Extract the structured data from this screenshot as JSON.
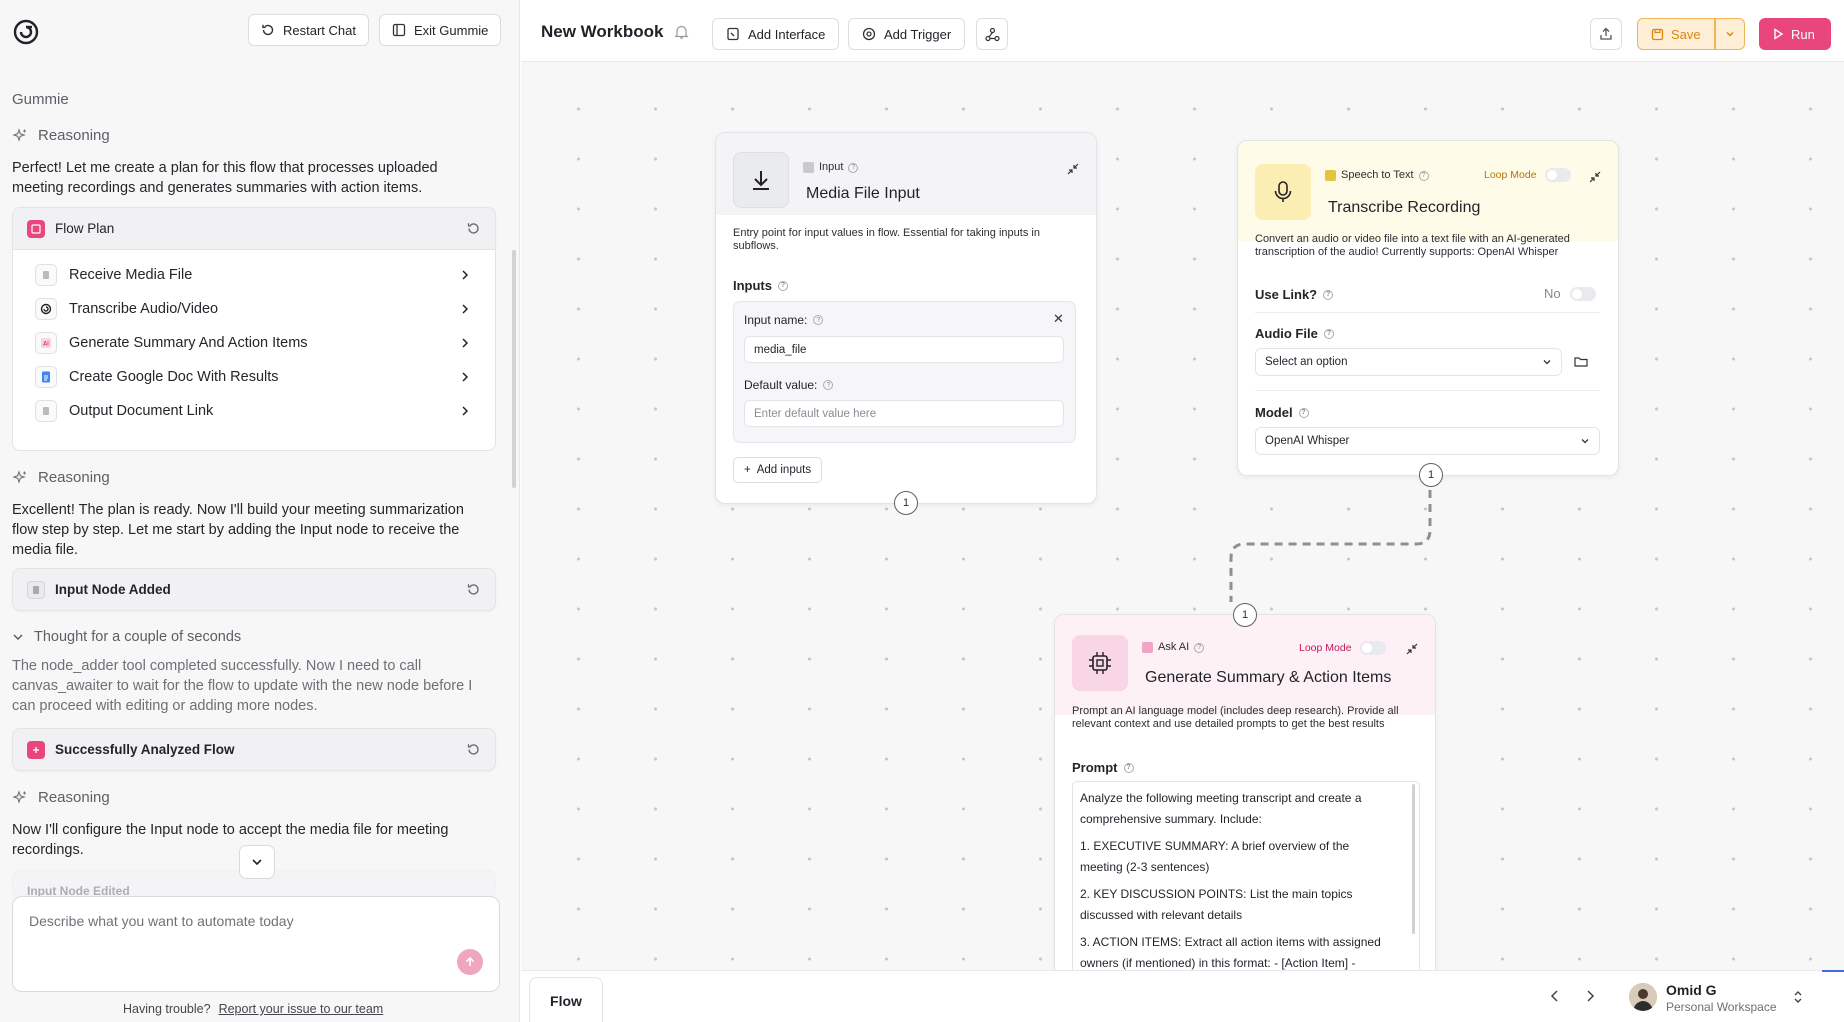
{
  "left_panel": {
    "restart_label": "Restart Chat",
    "exit_label": "Exit Gummie",
    "agent_name": "Gummie",
    "reasoning_label": "Reasoning",
    "msg1": "Perfect! Let me create a plan for this flow that processes uploaded meeting recordings and generates summaries with action items.",
    "flow_plan_title": "Flow Plan",
    "plan_items": [
      {
        "label": "Receive Media File"
      },
      {
        "label": "Transcribe Audio/Video"
      },
      {
        "label": "Generate Summary And Action Items"
      },
      {
        "label": "Create Google Doc With Results"
      },
      {
        "label": "Output Document Link"
      }
    ],
    "msg2": "Excellent! The plan is ready. Now I'll build your meeting summarization flow step by step. Let me start by adding the Input node to receive the media file.",
    "card_input_added": "Input Node Added",
    "thought_label": "Thought for a couple of seconds",
    "thought_text": "The node_adder tool completed successfully. Now I need to call canvas_awaiter to wait for the flow to update with the new node before I can proceed with editing or adding more nodes.",
    "card_analyzed": "Successfully Analyzed Flow",
    "msg3": "Now I'll configure the Input node to accept the media file for meeting recordings.",
    "card_edited": "Input Node Edited",
    "chat_placeholder": "Describe what you want to automate today",
    "trouble_text": "Having trouble?",
    "report_link": "Report your issue to our team"
  },
  "header": {
    "title": "New Workbook",
    "add_interface": "Add Interface",
    "add_trigger": "Add Trigger",
    "save": "Save",
    "run": "Run"
  },
  "nodes": {
    "input": {
      "type": "Input",
      "title": "Media File Input",
      "desc": "Entry point for input values in flow. Essential for taking inputs in subflows.",
      "inputs_label": "Inputs",
      "input_name_label": "Input name:",
      "input_name_value": "media_file",
      "default_label": "Default value:",
      "default_placeholder": "Enter default value here",
      "add_inputs": "Add inputs",
      "port": "1"
    },
    "speech": {
      "type": "Speech to Text",
      "loop_mode": "Loop Mode",
      "title": "Transcribe Recording",
      "desc": "Convert an audio or video file into a text file with an AI-generated transcription of the audio! Currently supports: OpenAI Whisper",
      "use_link_label": "Use Link?",
      "use_link_value": "No",
      "audio_file_label": "Audio File",
      "audio_file_placeholder": "Select an option",
      "model_label": "Model",
      "model_value": "OpenAI Whisper",
      "port": "1"
    },
    "askai": {
      "type": "Ask AI",
      "loop_mode": "Loop Mode",
      "title": "Generate Summary & Action Items",
      "desc": "Prompt an AI language model (includes deep research). Provide all relevant context and use detailed prompts to get the best results",
      "prompt_label": "Prompt",
      "prompt_lines": [
        "Analyze the following meeting transcript and create a comprehensive summary. Include:",
        "1. EXECUTIVE SUMMARY: A brief overview of the meeting (2-3 sentences)",
        "2. KEY DISCUSSION POINTS: List the main topics discussed with relevant details",
        "3. ACTION ITEMS: Extract all action items with assigned owners (if mentioned) in this format: - [Action Item] -"
      ],
      "port": "1"
    }
  },
  "footer": {
    "tab": "Flow",
    "user_name": "Omid G",
    "workspace": "Personal Workspace"
  },
  "colors": {
    "accent_pink": "#e8467c",
    "save_orange": "#f5a020",
    "speech_bg": "#fffbe9",
    "askai_bg": "#fdf1f6"
  }
}
